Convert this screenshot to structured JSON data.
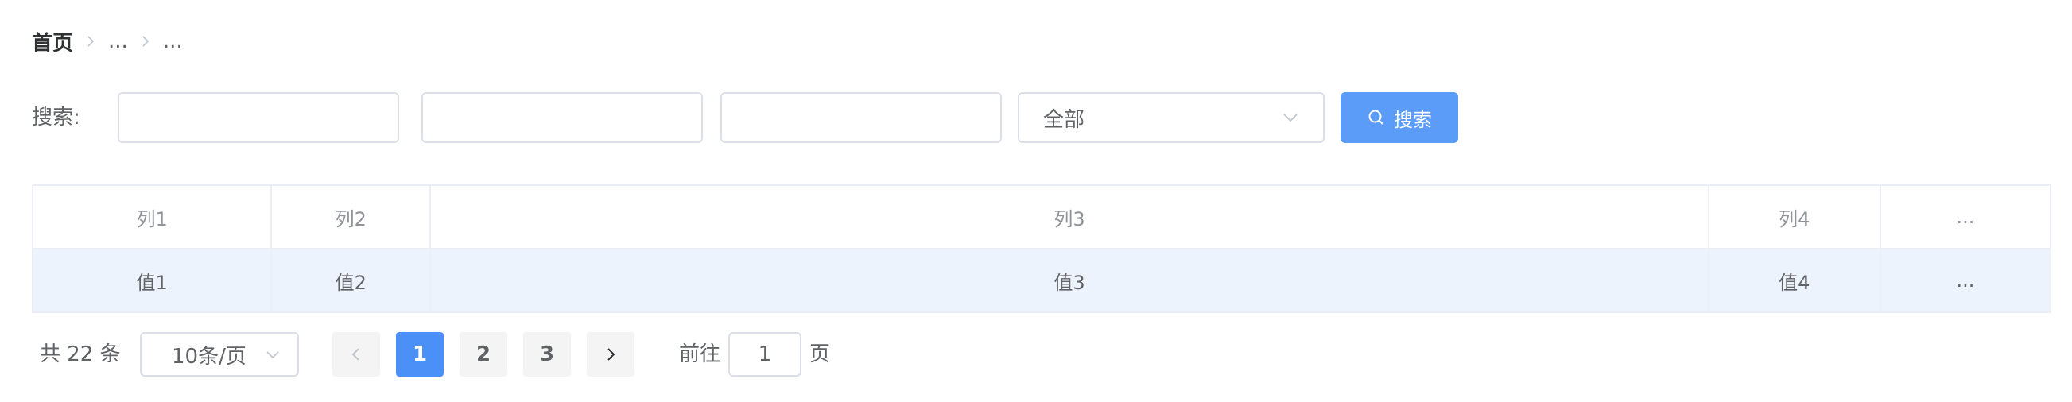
{
  "breadcrumb": {
    "items": [
      "首页",
      "...",
      "..."
    ]
  },
  "search": {
    "label": "搜索:",
    "input1_value": "",
    "input2_value": "",
    "input3_value": "",
    "select_value": "全部",
    "button_label": "搜索"
  },
  "table": {
    "columns": [
      "列1",
      "列2",
      "列3",
      "列4",
      "..."
    ],
    "rows": [
      [
        "值1",
        "值2",
        "值3",
        "值4",
        "..."
      ]
    ]
  },
  "pagination": {
    "total_text": "共 22 条",
    "page_size": "10条/页",
    "pages": [
      "1",
      "2",
      "3"
    ],
    "current_page": "1",
    "goto_label": "前往",
    "goto_value": "1",
    "goto_suffix": "页"
  },
  "colors": {
    "primary": "#4a90f7",
    "search_button": "#5b9cf8",
    "row_highlight": "#ecf3fd"
  },
  "icons": {
    "breadcrumb_separator": "chevron-right-icon",
    "select_arrow": "chevron-down-icon",
    "search_button": "search-icon",
    "prev_page": "chevron-left-icon",
    "next_page": "chevron-right-icon"
  }
}
